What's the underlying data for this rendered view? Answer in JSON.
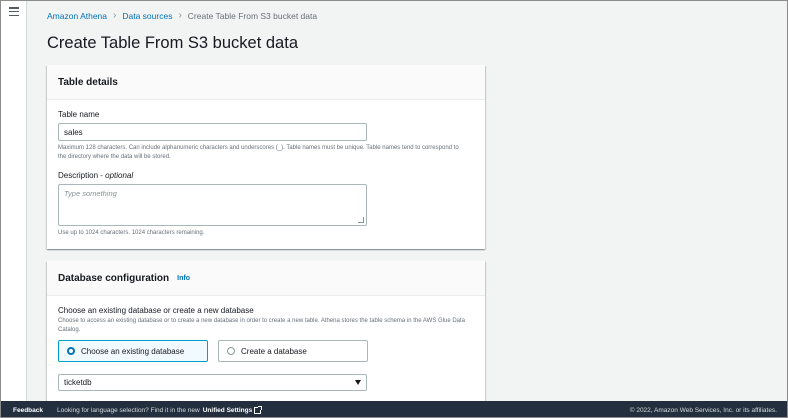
{
  "breadcrumb": {
    "items": [
      "Amazon Athena",
      "Data sources"
    ],
    "current": "Create Table From S3 bucket data"
  },
  "page": {
    "title": "Create Table From S3 bucket data"
  },
  "table_details": {
    "title": "Table details",
    "table_name_label": "Table name",
    "table_name_value": "sales",
    "table_name_hint": "Maximum 128 characters. Can include alphanumeric characters and underscores (_). Table names must be unique. Table names tend to correspond to the directory where the data will be stored.",
    "description_label": "Description - ",
    "description_optional": "optional",
    "description_placeholder": "Type something",
    "description_hint": "Use up to 1024 characters. 1024 characters remaining."
  },
  "database_config": {
    "title": "Database configuration",
    "info": "Info",
    "choose_label": "Choose an existing database or create a new database",
    "choose_hint": "Choose to access an existing database or to create a new database in order to create a new table. Athena stores the table schema in the AWS Glue Data Catalog.",
    "option_existing": "Choose an existing database",
    "option_create": "Create a database",
    "selected_database": "ticketdb"
  },
  "footer": {
    "feedback": "Feedback",
    "language_prompt": "Looking for language selection? Find it in the new",
    "unified_settings": "Unified Settings",
    "copyright": "© 2022, Amazon Web Services, Inc. or its affiliates."
  }
}
